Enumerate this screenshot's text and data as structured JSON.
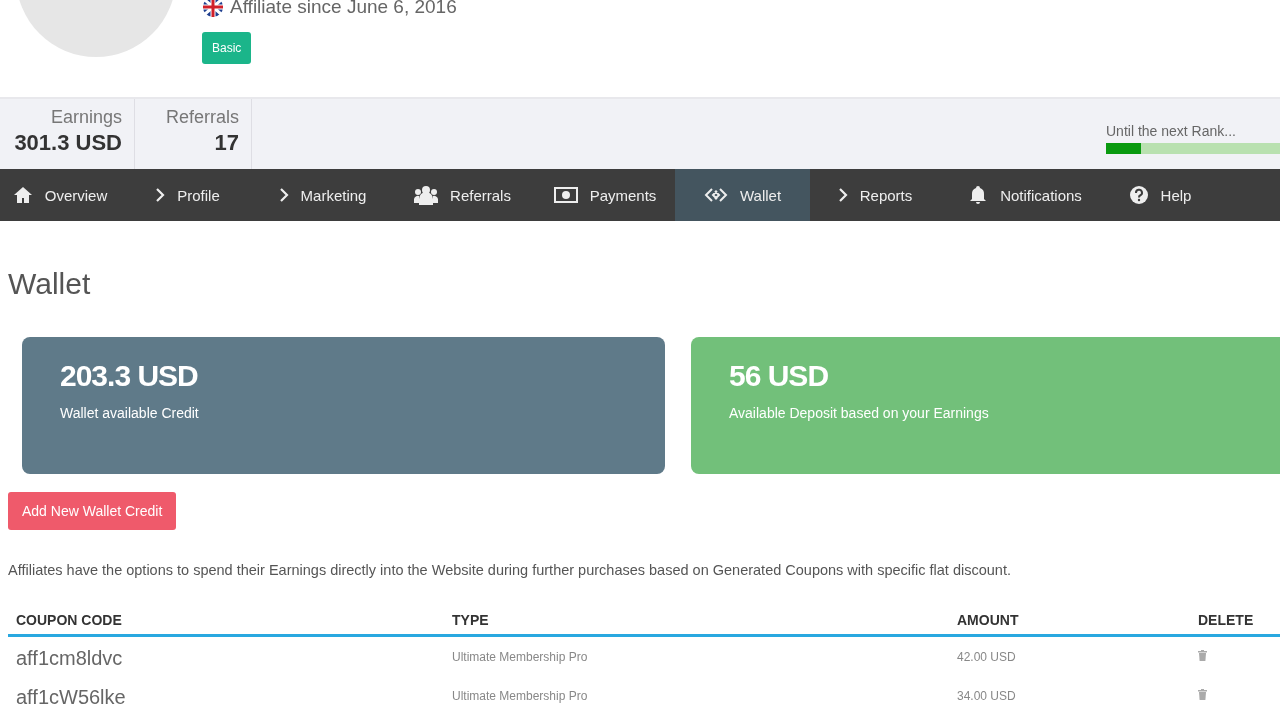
{
  "profile": {
    "member_since": "Affiliate since June 6, 2016",
    "rank_badge": "Basic"
  },
  "stats": [
    {
      "label": "Earnings",
      "value": "301.3 USD"
    },
    {
      "label": "Referrals",
      "value": "17"
    }
  ],
  "rank_progress": {
    "label": "Until the next Rank...",
    "level": 0.2
  },
  "nav": [
    {
      "label": "Overview",
      "selected": false
    },
    {
      "label": "Profile",
      "selected": false
    },
    {
      "label": "Marketing",
      "selected": false
    },
    {
      "label": "Referrals",
      "selected": false
    },
    {
      "label": "Payments",
      "selected": false
    },
    {
      "label": "Wallet",
      "selected": true
    },
    {
      "label": "Reports",
      "selected": false
    },
    {
      "label": "Notifications",
      "selected": false
    },
    {
      "label": "Help",
      "selected": false
    }
  ],
  "page_title": "Wallet",
  "cards": [
    {
      "amount": "203.3 USD",
      "caption": "Wallet available Credit",
      "color": "#5f7a89"
    },
    {
      "amount": "56 USD",
      "caption": "Available Deposit based on your Earnings",
      "color": "#72c07a"
    }
  ],
  "add_button": "Add New Wallet Credit",
  "description": "Affiliates have the options to spend their Earnings directly into the Website during further purchases based on Generated Coupons with specific flat discount.",
  "table": {
    "columns": [
      "COUPON CODE",
      "TYPE",
      "AMOUNT",
      "DELETE"
    ],
    "rows": [
      {
        "code": "aff1cm8ldvc",
        "type": "Ultimate Membership Pro",
        "amount": "42.00 USD"
      },
      {
        "code": "aff1cW56lke",
        "type": "Ultimate Membership Pro",
        "amount": "34.00 USD"
      }
    ]
  }
}
